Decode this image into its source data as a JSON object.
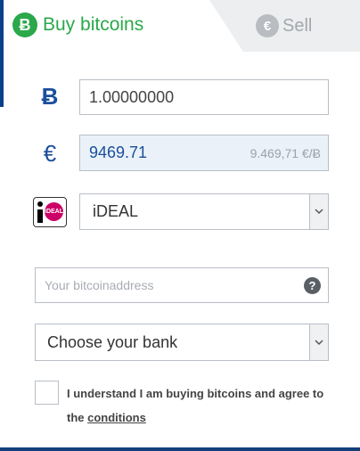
{
  "tabs": {
    "buy": {
      "label": "Buy bitcoins",
      "icon": "bitcoin-icon",
      "color": "#2aa84a"
    },
    "sell": {
      "label": "Sell",
      "icon": "euro-icon",
      "color": "#a4a7ab"
    }
  },
  "form": {
    "btc": {
      "symbol": "Ƀ",
      "icon": "bitcoin-symbol-icon",
      "value": "1.00000000"
    },
    "eur": {
      "symbol": "€",
      "icon": "euro-symbol-icon",
      "value": "9469.71",
      "rate": "9.469,71 €/Ƀ"
    },
    "payment_method": {
      "selected": "iDEAL",
      "logo": "ideal-logo",
      "logo_text": "iDEAL"
    },
    "address": {
      "placeholder": "Your bitcoinaddress",
      "value": ""
    },
    "bank": {
      "selected": "Choose your bank"
    },
    "terms": {
      "text": "I understand I am buying bitcoins and agree to the ",
      "link": "conditions"
    }
  },
  "colors": {
    "accent_blue": "#1a4f9c",
    "brand_green": "#2aa84a",
    "edge_navy": "#0a3f8c"
  }
}
